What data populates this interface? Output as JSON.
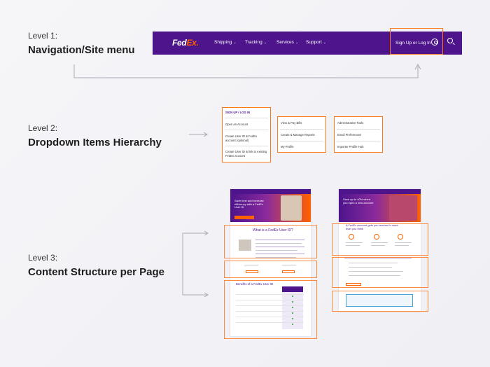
{
  "level1": {
    "label": "Level 1:",
    "title": "Navigation/Site menu"
  },
  "level2": {
    "label": "Level 2:",
    "title": "Dropdown Items Hierarchy"
  },
  "level3": {
    "label": "Level 3:",
    "title": "Content Structure per Page"
  },
  "nav": {
    "logo_main": "Fed",
    "logo_accent": "Ex",
    "logo_dot": ".",
    "items": [
      "Shipping",
      "Tracking",
      "Services",
      "Support"
    ],
    "signin": "Sign Up or Log In",
    "chevron": "⌄"
  },
  "dropdown": {
    "col1": {
      "header": "SIGN UP / LOG IN",
      "items": [
        "Open an Account",
        "Create User ID & FedEx account (optional)",
        "Create User ID & link to existing FedEx account"
      ]
    },
    "col2": {
      "items": [
        "View & Pay Bills",
        "Create & Manage Reports",
        "My Profile"
      ]
    },
    "col3": {
      "items": [
        "Administrative Tools",
        "Email Preferences",
        "Importer Profile Hub"
      ]
    }
  },
  "page1": {
    "hero": "Save time and increase efficiency with a FedEx User ID",
    "section1_heading": "What is a FedEx User ID?",
    "section3_heading": "Benefits of a FedEx User ID"
  },
  "page2": {
    "hero": "Save up to 40% when you open a new account",
    "section1_heading": "A FedEx account gets you access to more than you think"
  },
  "colors": {
    "brand_purple": "#4d148c",
    "brand_orange": "#ff6200",
    "highlight": "#ff7a1a"
  }
}
